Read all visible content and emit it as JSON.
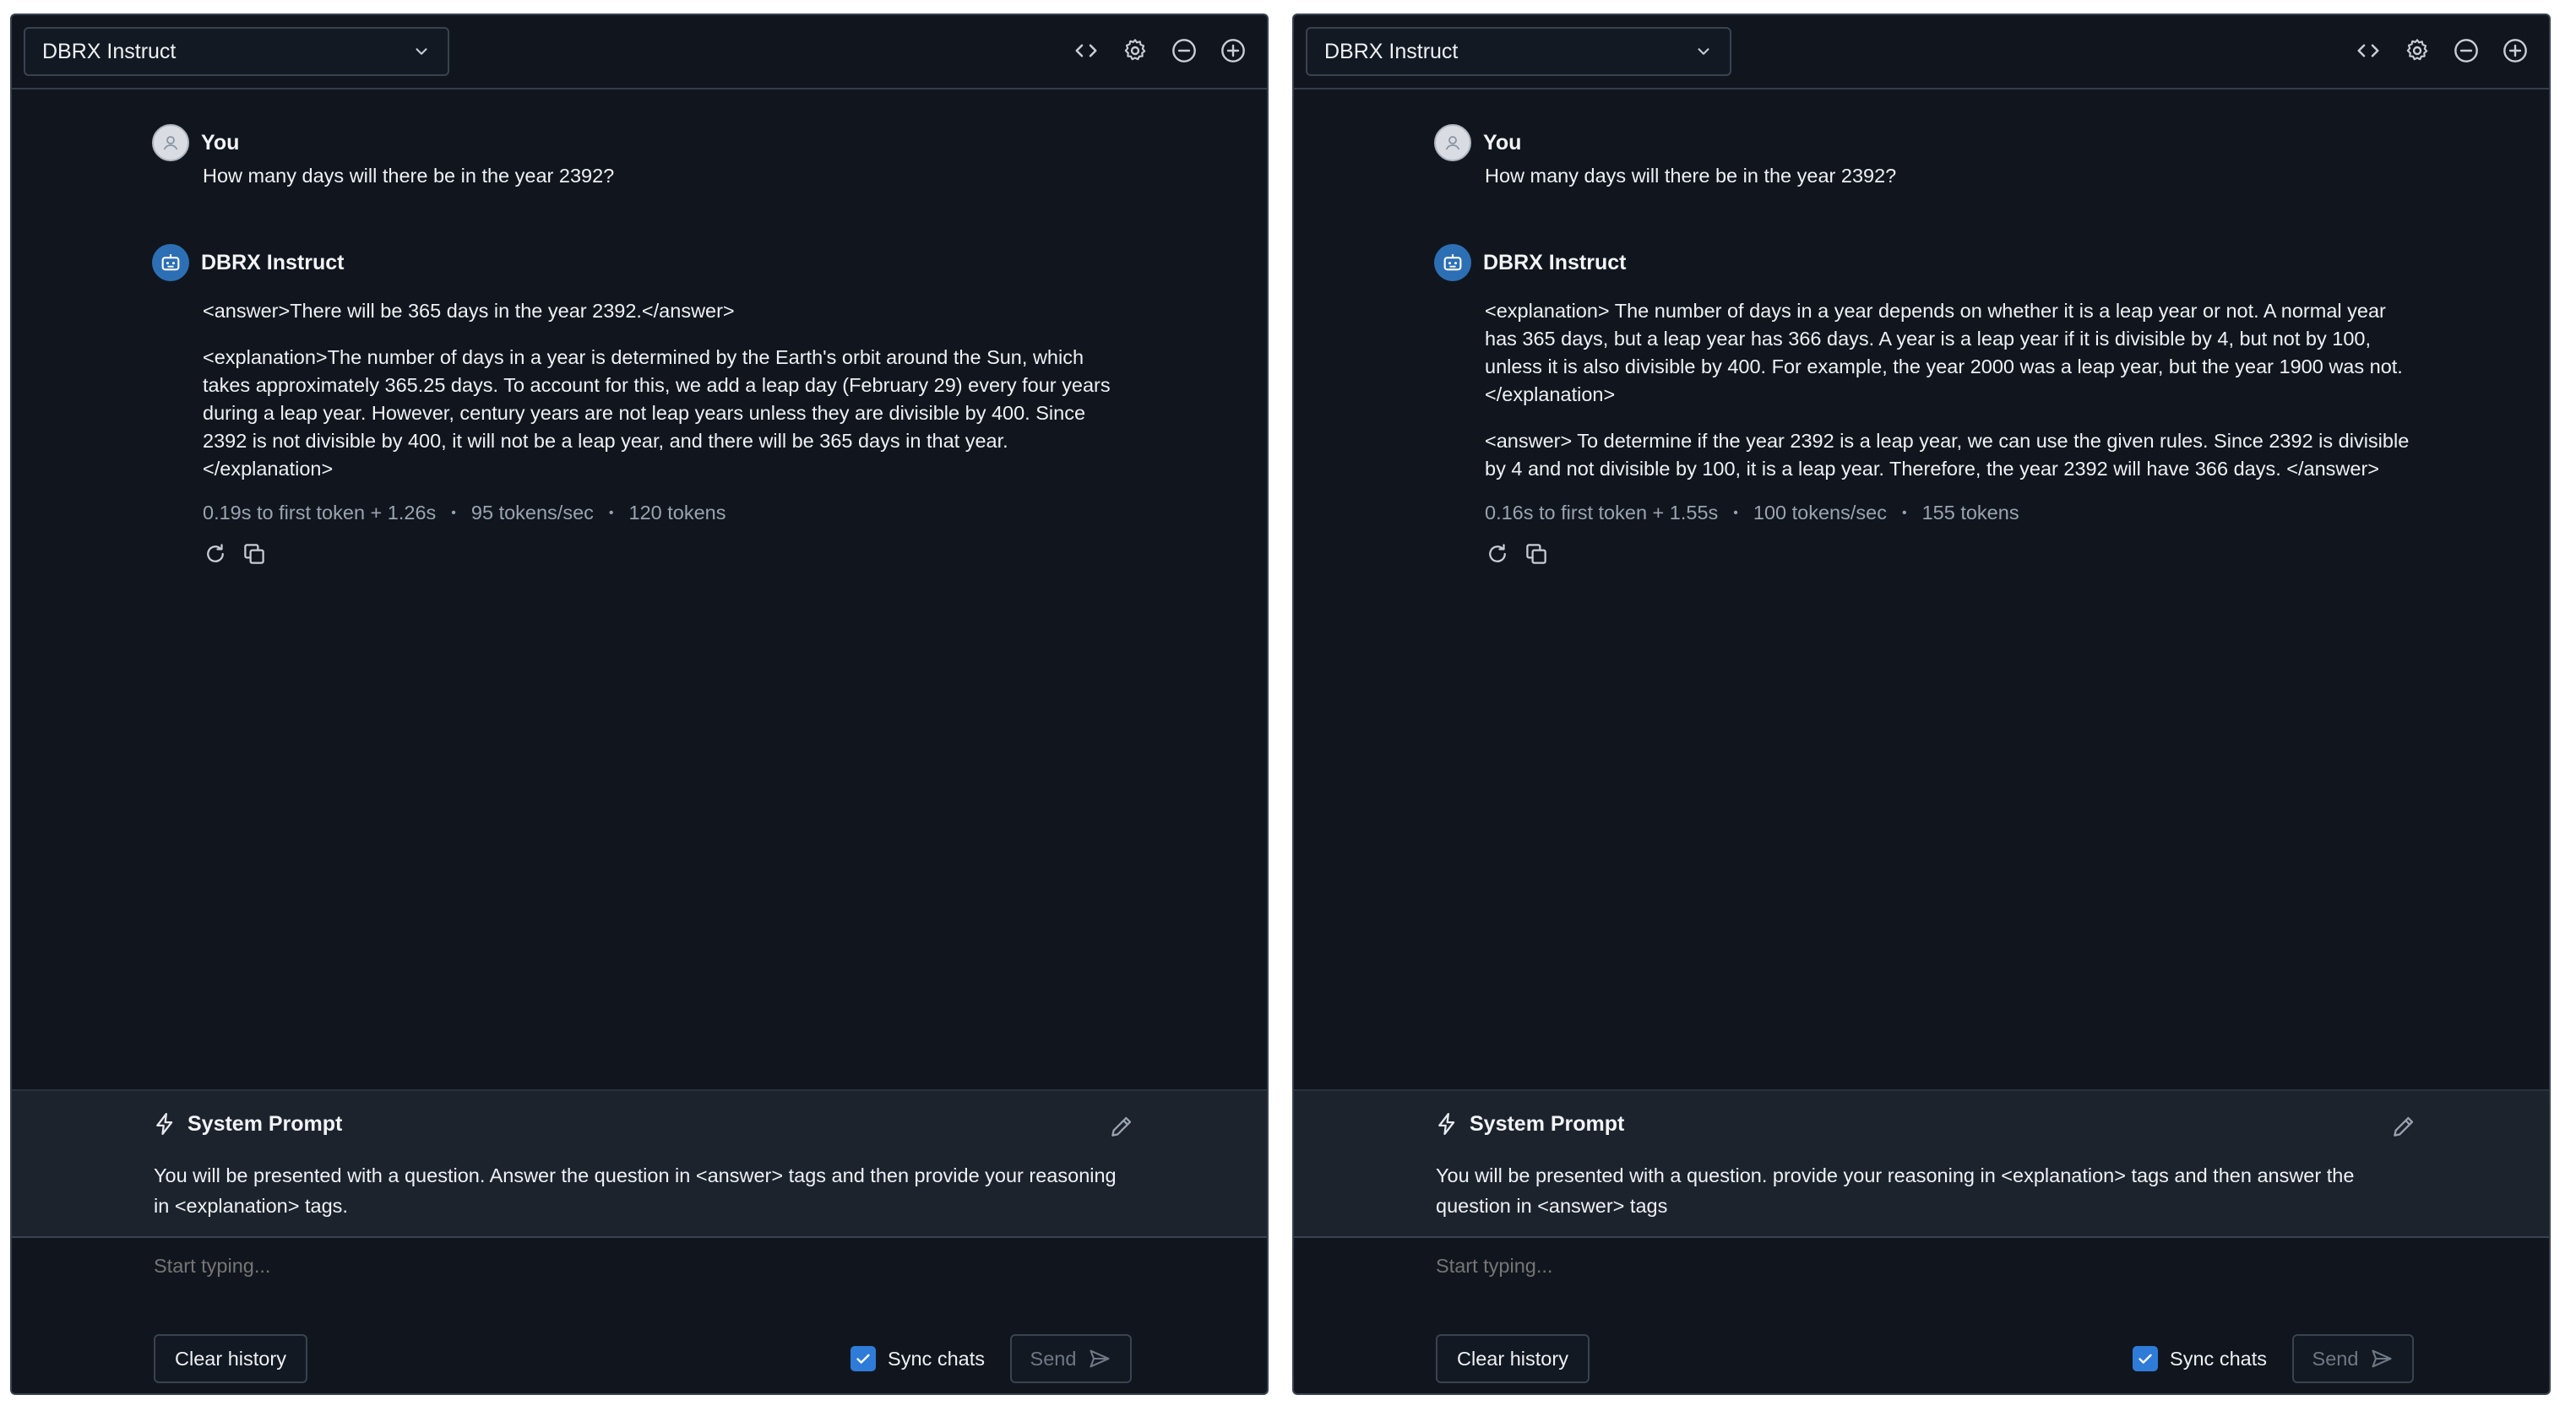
{
  "panels": [
    {
      "model_name": "DBRX Instruct",
      "user_author": "You",
      "user_message": "How many days will there be in the year 2392?",
      "bot_author": "DBRX Instruct",
      "response_paragraphs": [
        "<answer>There will be 365 days in the year 2392.</answer>",
        "<explanation>The number of days in a year is determined by the Earth's orbit around the Sun, which takes approximately 365.25 days. To account for this, we add a leap day (February 29) every four years during a leap year. However, century years are not leap years unless they are divisible by 400. Since 2392 is not divisible by 400, it will not be a leap year, and there will be 365 days in that year. </explanation>"
      ],
      "stats": {
        "latency": "0.19s to first token + 1.26s",
        "throughput": "95 tokens/sec",
        "tokens": "120 tokens"
      },
      "system_prompt_title": "System Prompt",
      "system_prompt": "You will be presented with a question. Answer the question in <answer> tags and then provide your reasoning in <explanation> tags.",
      "input_placeholder": "Start typing...",
      "clear_label": "Clear history",
      "sync_label": "Sync chats",
      "send_label": "Send"
    },
    {
      "model_name": "DBRX Instruct",
      "user_author": "You",
      "user_message": "How many days will there be in the year 2392?",
      "bot_author": "DBRX Instruct",
      "response_paragraphs": [
        "<explanation> The number of days in a year depends on whether it is a leap year or not. A normal year has 365 days, but a leap year has 366 days. A year is a leap year if it is divisible by 4, but not by 100, unless it is also divisible by 400. For example, the year 2000 was a leap year, but the year 1900 was not. </explanation>",
        "<answer> To determine if the year 2392 is a leap year, we can use the given rules. Since 2392 is divisible by 4 and not divisible by 100, it is a leap year. Therefore, the year 2392 will have 366 days. </answer>"
      ],
      "stats": {
        "latency": "0.16s to first token + 1.55s",
        "throughput": "100 tokens/sec",
        "tokens": "155 tokens"
      },
      "system_prompt_title": "System Prompt",
      "system_prompt": "You will be presented with a question. provide your reasoning in <explanation> tags and then answer the question in <answer> tags",
      "input_placeholder": "Start typing...",
      "clear_label": "Clear history",
      "sync_label": "Sync chats",
      "send_label": "Send"
    }
  ],
  "colors": {
    "panel_bg": "#11161e",
    "system_bg": "#1d232d",
    "border": "#3a4250",
    "accent": "#2f7bd8",
    "muted_text": "#9aa3b0"
  },
  "icons": {
    "header": [
      "code-icon",
      "gear-icon",
      "minus-circle-icon",
      "plus-circle-icon"
    ],
    "message_actions": [
      "regenerate-icon",
      "copy-icon"
    ],
    "system_prompt": [
      "lightning-icon",
      "pencil-icon"
    ],
    "send": "send-icon"
  }
}
